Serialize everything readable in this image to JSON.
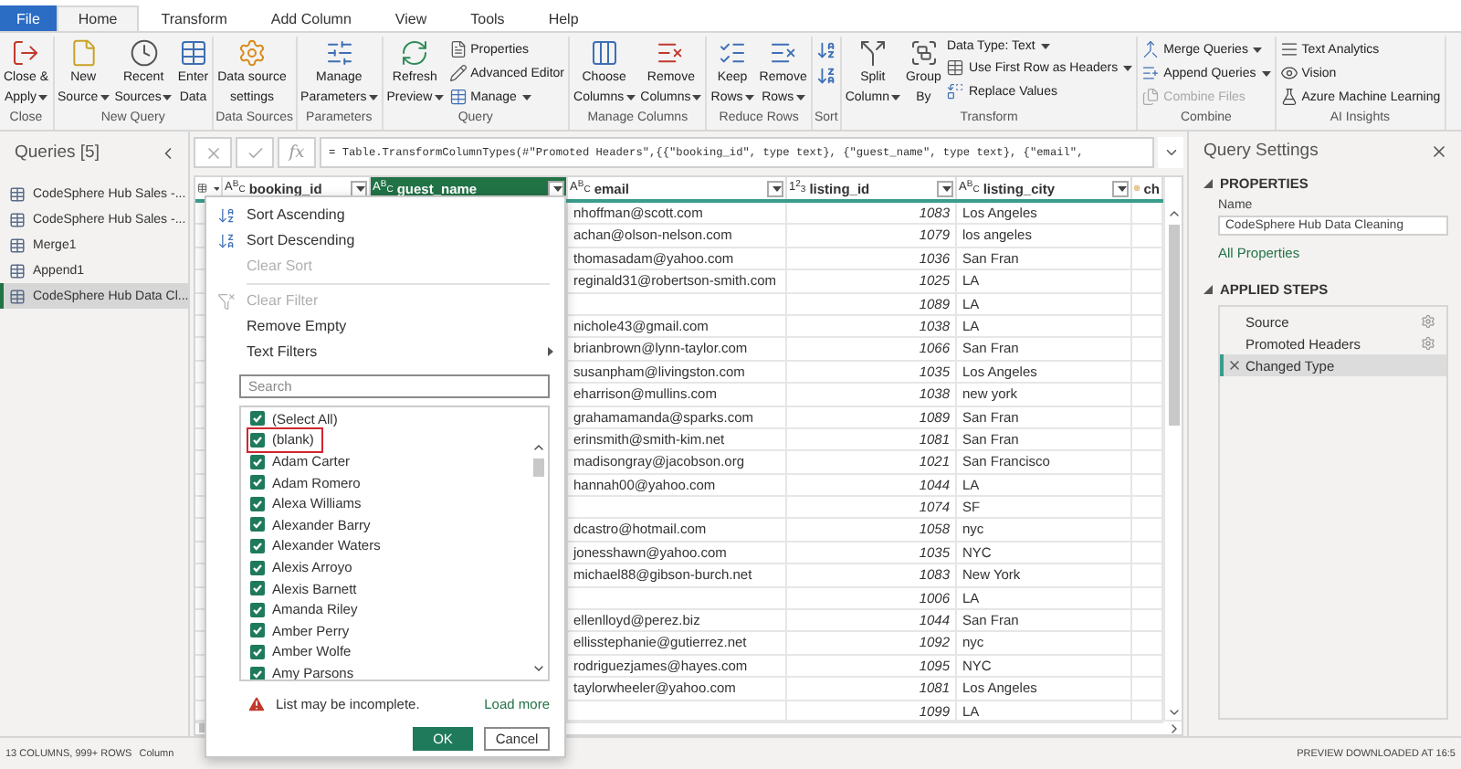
{
  "tabs": [
    {
      "label": "File",
      "kind": "file",
      "selected": false
    },
    {
      "label": "Home",
      "kind": "tab",
      "selected": true
    },
    {
      "label": "Transform",
      "kind": "tab",
      "selected": false
    },
    {
      "label": "Add Column",
      "kind": "tab",
      "selected": false
    },
    {
      "label": "View",
      "kind": "tab",
      "selected": false
    },
    {
      "label": "Tools",
      "kind": "tab",
      "selected": false
    },
    {
      "label": "Help",
      "kind": "tab",
      "selected": false
    }
  ],
  "ribbon": [
    {
      "label": "Close",
      "items": [
        {
          "kind": "large",
          "lines": [
            "Close &",
            "Apply"
          ],
          "dropdown": true
        }
      ]
    },
    {
      "label": "New Query",
      "items": [
        {
          "kind": "large",
          "lines": [
            "New",
            "Source"
          ],
          "dropdown": true
        },
        {
          "kind": "large",
          "lines": [
            "Recent",
            "Sources"
          ],
          "dropdown": true
        },
        {
          "kind": "large",
          "lines": [
            "Enter",
            "Data"
          ],
          "dropdown": false
        }
      ]
    },
    {
      "label": "Data Sources",
      "items": [
        {
          "kind": "large",
          "lines": [
            "Data source",
            "settings"
          ],
          "dropdown": false
        }
      ]
    },
    {
      "label": "Parameters",
      "items": [
        {
          "kind": "large",
          "lines": [
            "Manage",
            "Parameters"
          ],
          "dropdown": true
        }
      ]
    },
    {
      "label": "Query",
      "items": [
        {
          "kind": "large",
          "lines": [
            "Refresh",
            "Preview"
          ],
          "dropdown": true
        },
        {
          "kind": "stack",
          "items": [
            {
              "label": "Properties",
              "dropdown": false,
              "disabled": false
            },
            {
              "label": "Advanced Editor",
              "dropdown": false,
              "disabled": false
            },
            {
              "label": "Manage",
              "dropdown": true,
              "disabled": false
            }
          ]
        }
      ]
    },
    {
      "label": "Manage Columns",
      "items": [
        {
          "kind": "large",
          "lines": [
            "Choose",
            "Columns"
          ],
          "dropdown": true
        },
        {
          "kind": "large",
          "lines": [
            "Remove",
            "Columns"
          ],
          "dropdown": true
        }
      ]
    },
    {
      "label": "Reduce Rows",
      "items": [
        {
          "kind": "large",
          "lines": [
            "Keep",
            "Rows"
          ],
          "dropdown": true
        },
        {
          "kind": "large",
          "lines": [
            "Remove",
            "Rows"
          ],
          "dropdown": true
        }
      ]
    },
    {
      "label": "Sort",
      "items": [
        {
          "kind": "icons"
        }
      ]
    },
    {
      "label": "Transform",
      "items": [
        {
          "kind": "large",
          "lines": [
            "Split",
            "Column"
          ],
          "dropdown": true
        },
        {
          "kind": "large",
          "lines": [
            "Group",
            "By"
          ],
          "dropdown": false
        },
        {
          "kind": "stack",
          "items": [
            {
              "label": "Data Type: Text",
              "dropdown": true,
              "disabled": false
            },
            {
              "label": "Use First Row as Headers",
              "dropdown": true,
              "disabled": false
            },
            {
              "label": "Replace Values",
              "dropdown": false,
              "disabled": false
            }
          ]
        }
      ]
    },
    {
      "label": "Combine",
      "items": [
        {
          "kind": "stack",
          "items": [
            {
              "label": "Merge Queries",
              "dropdown": true,
              "disabled": false
            },
            {
              "label": "Append Queries",
              "dropdown": true,
              "disabled": false
            },
            {
              "label": "Combine Files",
              "dropdown": false,
              "disabled": true
            }
          ]
        }
      ]
    },
    {
      "label": "AI Insights",
      "items": [
        {
          "kind": "stack",
          "items": [
            {
              "label": "Text Analytics",
              "dropdown": false,
              "disabled": false
            },
            {
              "label": "Vision",
              "dropdown": false,
              "disabled": false
            },
            {
              "label": "Azure Machine Learning",
              "dropdown": false,
              "disabled": false
            }
          ]
        }
      ]
    }
  ],
  "queries": {
    "title": "Queries [5]",
    "items": [
      {
        "label": "CodeSphere Hub Sales -...",
        "selected": false
      },
      {
        "label": "CodeSphere Hub Sales -...",
        "selected": false
      },
      {
        "label": "Merge1",
        "selected": false
      },
      {
        "label": "Append1",
        "selected": false
      },
      {
        "label": "CodeSphere Hub Data Cl...",
        "selected": true
      }
    ]
  },
  "formula_bar": {
    "fx": "fx",
    "text": "= Table.TransformColumnTypes(#\"Promoted Headers\",{{\"booking_id\", type text}, {\"guest_name\", type text}, {\"email\","
  },
  "grid": {
    "columns": [
      {
        "name": "booking_id",
        "kind": "text",
        "type": "A$^{B}$$_{C}$",
        "selected": false
      },
      {
        "name": "guest_name",
        "kind": "text",
        "type": "A$^{B}$$_{C}$",
        "selected": true
      },
      {
        "name": "email",
        "kind": "text",
        "type": "A$^{B}$$_{C}$",
        "selected": false
      },
      {
        "name": "listing_id",
        "kind": "number",
        "type": "1$^{2}$$_{3}$",
        "selected": false
      },
      {
        "name": "listing_city",
        "kind": "text",
        "type": "A$^{B}$$_{C}$",
        "selected": false
      },
      {
        "name": "ch",
        "kind": "other",
        "selected": false
      }
    ],
    "rows": [
      {
        "email": "nhoffman@scott.com",
        "listing_id": "1083",
        "listing_city": "Los Angeles"
      },
      {
        "email": "achan@olson-nelson.com",
        "listing_id": "1079",
        "listing_city": "los angeles"
      },
      {
        "email": "thomasadam@yahoo.com",
        "listing_id": "1036",
        "listing_city": "San Fran"
      },
      {
        "email": "reginald31@robertson-smith.com",
        "listing_id": "1025",
        "listing_city": "LA"
      },
      {
        "listing_id": "1089",
        "listing_city": "LA"
      },
      {
        "email": "nichole43@gmail.com",
        "listing_id": "1038",
        "listing_city": "LA"
      },
      {
        "email": "brianbrown@lynn-taylor.com",
        "listing_id": "1066",
        "listing_city": "San Fran"
      },
      {
        "email": "susanpham@livingston.com",
        "listing_id": "1035",
        "listing_city": "Los Angeles"
      },
      {
        "email": "eharrison@mullins.com",
        "listing_id": "1038",
        "listing_city": "new york"
      },
      {
        "email": "grahamamanda@sparks.com",
        "listing_id": "1089",
        "listing_city": "San Fran"
      },
      {
        "email": "erinsmith@smith-kim.net",
        "listing_id": "1081",
        "listing_city": "San Fran"
      },
      {
        "email": "madisongray@jacobson.org",
        "listing_id": "1021",
        "listing_city": "San Francisco"
      },
      {
        "email": "hannah00@yahoo.com",
        "listing_id": "1044",
        "listing_city": "LA"
      },
      {
        "listing_id": "1074",
        "listing_city": "SF"
      },
      {
        "email": "dcastro@hotmail.com",
        "listing_id": "1058",
        "listing_city": "nyc"
      },
      {
        "email": "jonesshawn@yahoo.com",
        "listing_id": "1035",
        "listing_city": "NYC"
      },
      {
        "email": "michael88@gibson-burch.net",
        "listing_id": "1083",
        "listing_city": "New York"
      },
      {
        "listing_id": "1006",
        "listing_city": "LA"
      },
      {
        "email": "ellenlloyd@perez.biz",
        "listing_id": "1044",
        "listing_city": "San Fran"
      },
      {
        "email": "ellisstephanie@gutierrez.net",
        "listing_id": "1092",
        "listing_city": "nyc"
      },
      {
        "email": "rodriguezjames@hayes.com",
        "listing_id": "1095",
        "listing_city": "NYC"
      },
      {
        "email": "taylorwheeler@yahoo.com",
        "listing_id": "1081",
        "listing_city": "Los Angeles"
      },
      {
        "listing_id": "1099",
        "listing_city": "LA"
      }
    ]
  },
  "filter_menu": {
    "items": [
      {
        "kind": "command",
        "label": "Sort Ascending",
        "disabled": false
      },
      {
        "kind": "command",
        "label": "Sort Descending",
        "disabled": false
      },
      {
        "kind": "command",
        "label": "Clear Sort",
        "disabled": true
      },
      {
        "kind": "separator"
      },
      {
        "kind": "command",
        "label": "Clear Filter",
        "disabled": true
      },
      {
        "kind": "command",
        "label": "Remove Empty",
        "disabled": false
      },
      {
        "kind": "submenu",
        "label": "Text Filters",
        "disabled": false
      }
    ],
    "search": {
      "placeholder": "Search"
    },
    "values": [
      {
        "label": "(Select All)",
        "checked": true,
        "highlighted": false
      },
      {
        "label": "(blank)",
        "checked": true,
        "highlighted": true
      },
      {
        "label": "Adam Carter",
        "checked": true,
        "highlighted": false
      },
      {
        "label": "Adam Romero",
        "checked": true,
        "highlighted": false
      },
      {
        "label": "Alexa Williams",
        "checked": true,
        "highlighted": false
      },
      {
        "label": "Alexander Barry",
        "checked": true,
        "highlighted": false
      },
      {
        "label": "Alexander Waters",
        "checked": true,
        "highlighted": false
      },
      {
        "label": "Alexis Arroyo",
        "checked": true,
        "highlighted": false
      },
      {
        "label": "Alexis Barnett",
        "checked": true,
        "highlighted": false
      },
      {
        "label": "Amanda Riley",
        "checked": true,
        "highlighted": false
      },
      {
        "label": "Amber Perry",
        "checked": true,
        "highlighted": false
      },
      {
        "label": "Amber Wolfe",
        "checked": true,
        "highlighted": false
      },
      {
        "label": "Amy Parsons",
        "checked": true,
        "highlighted": false
      }
    ],
    "warning": "List may be incomplete.",
    "load_more": "Load more",
    "buttons": [
      {
        "label": "OK",
        "kind": "primary"
      },
      {
        "label": "Cancel",
        "kind": "secondary"
      }
    ]
  },
  "query_settings": {
    "title": "Query Settings",
    "properties": {
      "heading": "PROPERTIES",
      "name_label": "Name",
      "name_value": "CodeSphere Hub Data Cleaning",
      "link": "All Properties"
    },
    "applied_steps": {
      "heading": "APPLIED STEPS",
      "steps": [
        {
          "label": "Source",
          "settings": true,
          "selected": false
        },
        {
          "label": "Promoted Headers",
          "settings": true,
          "selected": false
        },
        {
          "label": "Changed Type",
          "settings": false,
          "selected": true
        }
      ]
    }
  },
  "status_bar": {
    "left": [
      "13 COLUMNS, 999+ ROWS",
      "Column"
    ],
    "right": "PREVIEW DOWNLOADED AT 16:5"
  }
}
